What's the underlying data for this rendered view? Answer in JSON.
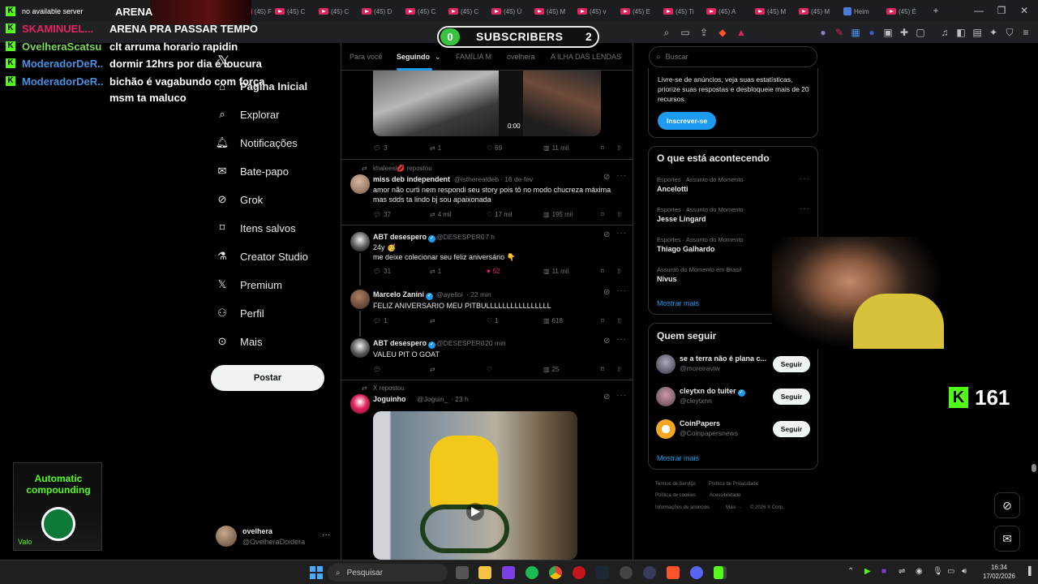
{
  "browser": {
    "tabs": [
      "(45) F",
      "(45) C",
      "(45) C",
      "(45) D",
      "(45) C",
      "(45) C",
      "(45) Ú",
      "(45) M",
      "(45) v",
      "(45) E",
      "(45) Ti",
      "(45) A",
      "(45) M",
      "(45) M",
      "Heim",
      "(45) É"
    ],
    "new_tab": "+",
    "window_controls": [
      "—",
      "❐",
      "✕"
    ]
  },
  "chat": {
    "lines": [
      {
        "user": "no available server",
        "msg": "ARENA",
        "color": "#ffffff"
      },
      {
        "user": "SKAMINUEL...",
        "msg": "ARENA PRA PASSAR TEMPO",
        "color": "#e0245e"
      },
      {
        "user": "OvelheraScatsu",
        "msg": "clt arruma horario rapidin",
        "color": "#7ed957"
      },
      {
        "user": "ModeradorDeR...",
        "msg": "dormir 12hrs por dia é loucura",
        "color": "#4a90e2"
      },
      {
        "user": "ModeradorDeR...",
        "msg": "bichão é vagabundo com força",
        "color": "#4a90e2"
      },
      {
        "user": "",
        "msg": "msm ta maluco",
        "color": "#ffffff"
      }
    ]
  },
  "subs": {
    "left": "0",
    "label": "SUBSCRIBERS",
    "right": "2"
  },
  "nav": {
    "items": [
      {
        "label": "Página Inicial",
        "icon": "home-icon"
      },
      {
        "label": "Explorar",
        "icon": "search-icon"
      },
      {
        "label": "Notificações",
        "icon": "bell-icon"
      },
      {
        "label": "Bate-papo",
        "icon": "mail-icon"
      },
      {
        "label": "Grok",
        "icon": "grok-icon"
      },
      {
        "label": "Itens salvos",
        "icon": "bookmark-icon"
      },
      {
        "label": "Creator Studio",
        "icon": "flask-icon"
      },
      {
        "label": "Premium",
        "icon": "x-logo-icon"
      },
      {
        "label": "Perfil",
        "icon": "person-icon"
      },
      {
        "label": "Mais",
        "icon": "more-circle-icon"
      }
    ],
    "post_label": "Postar",
    "account": {
      "name": "ovelhera",
      "handle": "@OvelheraDoidera",
      "more": "···"
    }
  },
  "timeline": {
    "tabs": [
      "Para você",
      "Seguindo",
      "FAMÍLIA M",
      "ovelhera",
      "A ILHA DAS LENDAS"
    ],
    "video_time": "0:00",
    "tweet0_actions": {
      "replies": "3",
      "retweets": "1",
      "likes": "69",
      "views": "11 mil"
    },
    "tweet1": {
      "repost_label": "khaleesi💋 repostou",
      "name": "miss deb independent",
      "handle": "@isthereal​deb",
      "time": "· 16 de fev",
      "text": "amor não curti nem respondi seu story pois tô no modo chucreza máxima mas sdds ta lindo bj sou apaixonada",
      "replies": "37",
      "retweets": "4 mil",
      "likes": "17 mil",
      "views": "195 mil"
    },
    "tweet2": {
      "name": "ABT desespero",
      "handle": "@DESESPER0",
      "time": "· 7 h",
      "text1": "24y 🥳",
      "text2": "me deixe colecionar seu feliz aniversário 👇",
      "replies": "31",
      "retweets": "1",
      "likes": "52",
      "views": "11 mil"
    },
    "tweet3": {
      "name": "Marcelo Zanini",
      "handle": "@ayelloi",
      "time": "· 22 min",
      "text": "FELIZ ANIVERSARIO MEU PITBULLLLLLLLLLLLLLLL",
      "replies": "1",
      "retweets": "",
      "likes": "1",
      "views": "618"
    },
    "tweet4": {
      "name": "ABT desespero",
      "handle": "@DESESPER0",
      "time": "· 20 min",
      "text": "VALEU PIT O GOAT",
      "replies": "",
      "retweets": "",
      "likes": "",
      "views": "25"
    },
    "tweet5": {
      "repost_label": "X repostou",
      "name": "Joguinho",
      "handle": "@Joguin_",
      "time": "· 23 h"
    }
  },
  "sidebar": {
    "search_placeholder": "Buscar",
    "premium": {
      "text": "Livre-se de anúncios, veja suas estatísticas, priorize suas respostas e desbloqueie mais de 20 recursos.",
      "button": "Inscrever-se"
    },
    "trends": {
      "title": "O que está acontecendo",
      "items": [
        {
          "category": "Esportes · Assunto do Momento",
          "name": "Ancelotti"
        },
        {
          "category": "Esportes · Assunto do Momento",
          "name": "Jesse Lingard"
        },
        {
          "category": "Esportes · Assunto do Momento",
          "name": "Thiago Galhardo"
        },
        {
          "category": "Assunto do Momento em Brasil",
          "name": "Nivus"
        }
      ],
      "more": "Mostrar mais"
    },
    "who_to_follow": {
      "title": "Quem seguir",
      "items": [
        {
          "name": "se a terra não é plana c...",
          "handle": "@moreiraviw",
          "button": "Seguir"
        },
        {
          "name": "cleytxn do tuiter",
          "handle": "@cleytxnn",
          "button": "Seguir"
        },
        {
          "name": "CoinPapers",
          "handle": "@Coinpapersnews",
          "button": "Seguir"
        }
      ],
      "more": "Mostrar mais"
    },
    "footer": [
      "Termos de Serviço",
      "Política de Privacidade",
      "Política de cookies",
      "Acessibilidade",
      "Informações de anúncios",
      "Mais ···",
      "© 2026 X Corp."
    ]
  },
  "kick": {
    "count": "161"
  },
  "ad": {
    "title": "Automatic compounding",
    "badge": "Valo"
  },
  "taskbar": {
    "search": "Pesquisar",
    "time": "16:34",
    "date": "17/02/2026"
  }
}
